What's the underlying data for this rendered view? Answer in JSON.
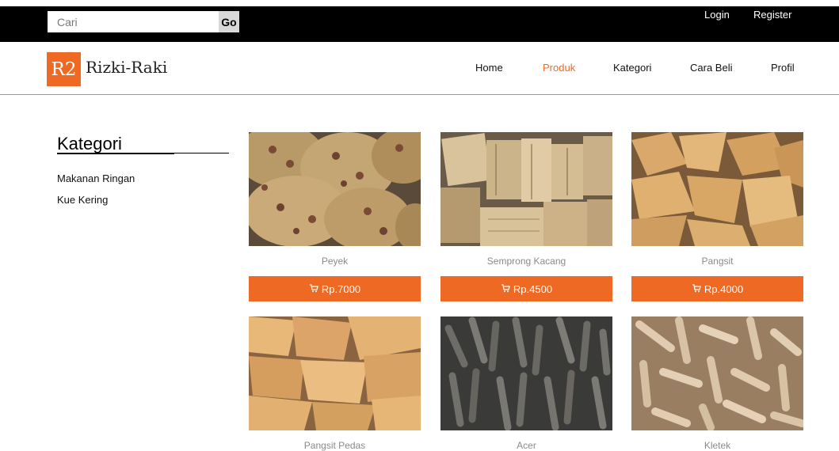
{
  "topbar": {
    "search_placeholder": "Cari",
    "go_label": "Go",
    "login_label": "Login",
    "register_label": "Register"
  },
  "header": {
    "logo_mark": "R2",
    "logo_text": "Rizki-Raki",
    "nav": [
      {
        "label": "Home"
      },
      {
        "label": "Produk",
        "active": true
      },
      {
        "label": "Kategori"
      },
      {
        "label": "Cara Beli"
      },
      {
        "label": "Profil"
      }
    ]
  },
  "sidebar": {
    "title": "Kategori",
    "items": [
      {
        "label": "Makanan Ringan"
      },
      {
        "label": "Kue Kering"
      }
    ]
  },
  "products": [
    {
      "name": "Peyek",
      "price": "Rp.7000",
      "icon": "cart-icon"
    },
    {
      "name": "Semprong Kacang",
      "price": "Rp.4500",
      "icon": "cart-icon"
    },
    {
      "name": "Pangsit",
      "price": "Rp.4000",
      "icon": "cart-icon"
    },
    {
      "name": "Pangsit Pedas",
      "price": "",
      "icon": "cart-icon"
    },
    {
      "name": "Acer",
      "price": "",
      "icon": "cart-icon"
    },
    {
      "name": "Kletek",
      "price": "",
      "icon": "cart-icon"
    }
  ],
  "colors": {
    "accent": "#ee6a24",
    "topbar": "#000000"
  }
}
